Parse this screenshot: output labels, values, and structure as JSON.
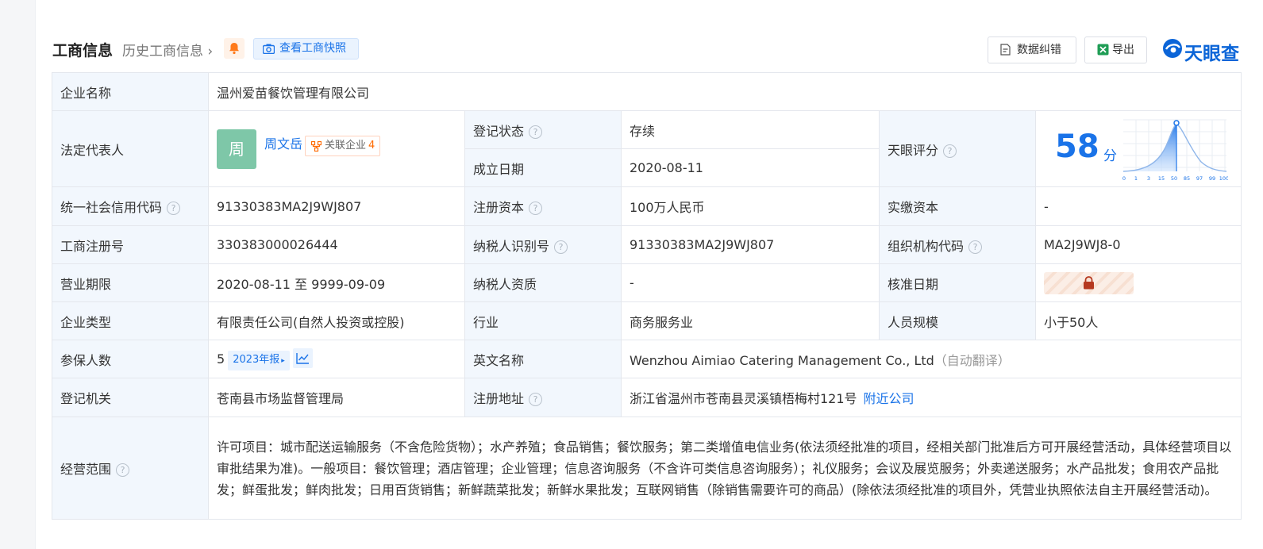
{
  "header": {
    "title": "工商信息",
    "history_link": "历史工商信息",
    "snapshot_button": "查看工商快照",
    "correct_button": "数据纠错",
    "export_button": "导出",
    "logo_text": "天眼查"
  },
  "company": {
    "name_label": "企业名称",
    "name": "温州爱苗餐饮管理有限公司",
    "legal_rep_label": "法定代表人",
    "legal_rep_avatar": "周",
    "legal_rep_name": "周文岳",
    "related_label": "关联企业",
    "related_count": "4",
    "reg_status_label": "登记状态",
    "reg_status": "存续",
    "found_date_label": "成立日期",
    "found_date": "2020-08-11",
    "score_label": "天眼评分",
    "score": "58",
    "score_unit": "分",
    "score_ticks": [
      "0",
      "1",
      "3",
      "15",
      "50",
      "85",
      "97",
      "99",
      "100"
    ],
    "credit_code_label": "统一社会信用代码",
    "credit_code": "91330383MA2J9WJ807",
    "reg_capital_label": "注册资本",
    "reg_capital": "100万人民币",
    "paid_capital_label": "实缴资本",
    "paid_capital": "-",
    "reg_no_label": "工商注册号",
    "reg_no": "330383000026444",
    "taxpayer_id_label": "纳税人识别号",
    "taxpayer_id": "91330383MA2J9WJ807",
    "org_code_label": "组织机构代码",
    "org_code": "MA2J9WJ8-0",
    "term_label": "营业期限",
    "term": "2020-08-11 至 9999-09-09",
    "taxpayer_qual_label": "纳税人资质",
    "taxpayer_qual": "-",
    "approval_date_label": "核准日期",
    "type_label": "企业类型",
    "type": "有限责任公司(自然人投资或控股)",
    "industry_label": "行业",
    "industry": "商务服务业",
    "staff_label": "人员规模",
    "staff": "小于50人",
    "insured_label": "参保人数",
    "insured": "5",
    "insured_report": "2023年报",
    "english_name_label": "英文名称",
    "english_name": "Wenzhou Aimiao Catering Management Co., Ltd",
    "auto_translate": "（自动翻译）",
    "authority_label": "登记机关",
    "authority": "苍南县市场监督管理局",
    "address_label": "注册地址",
    "address": "浙江省温州市苍南县灵溪镇梧梅村121号",
    "nearby_link": "附近公司",
    "scope_label": "经营范围",
    "scope": "许可项目：城市配送运输服务（不含危险货物）；水产养殖；食品销售；餐饮服务；第二类增值电信业务(依法须经批准的项目，经相关部门批准后方可开展经营活动，具体经营项目以审批结果为准)。一般项目：餐饮管理；酒店管理；企业管理；信息咨询服务（不含许可类信息咨询服务）；礼仪服务；会议及展览服务；外卖递送服务；水产品批发；食用农产品批发；鲜蛋批发；鲜肉批发；日用百货销售；新鲜蔬菜批发；新鲜水果批发；互联网销售（除销售需要许可的商品）(除依法须经批准的项目外，凭营业执照依法自主开展经营活动)。"
  },
  "colors": {
    "accent": "#1a73e8",
    "status_green": "#2aa44f",
    "label_bg": "#f2f7fd",
    "warn_orange": "#ff6a00"
  }
}
